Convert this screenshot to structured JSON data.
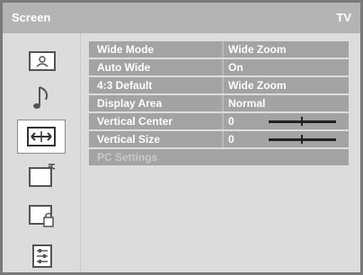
{
  "title": {
    "left": "Screen",
    "right": "TV"
  },
  "menu": [
    {
      "label": "Wide Mode",
      "value": "Wide Zoom"
    },
    {
      "label": "Auto Wide",
      "value": "On"
    },
    {
      "label": "4:3 Default",
      "value": "Wide Zoom"
    },
    {
      "label": "Display Area",
      "value": "Normal"
    },
    {
      "label": "Vertical Center",
      "value": "0",
      "slider_level": 0.5
    },
    {
      "label": "Vertical Size",
      "value": "0",
      "slider_level": 0.5
    },
    {
      "label": "PC Settings",
      "value": ""
    }
  ],
  "sidebar": {
    "items": [
      {
        "icon": "picture-icon"
      },
      {
        "icon": "music-note-icon"
      },
      {
        "icon": "screen-wide-icon",
        "active": true
      },
      {
        "icon": "setup-icon"
      },
      {
        "icon": "lock-icon"
      },
      {
        "icon": "preset-list-icon"
      }
    ]
  }
}
